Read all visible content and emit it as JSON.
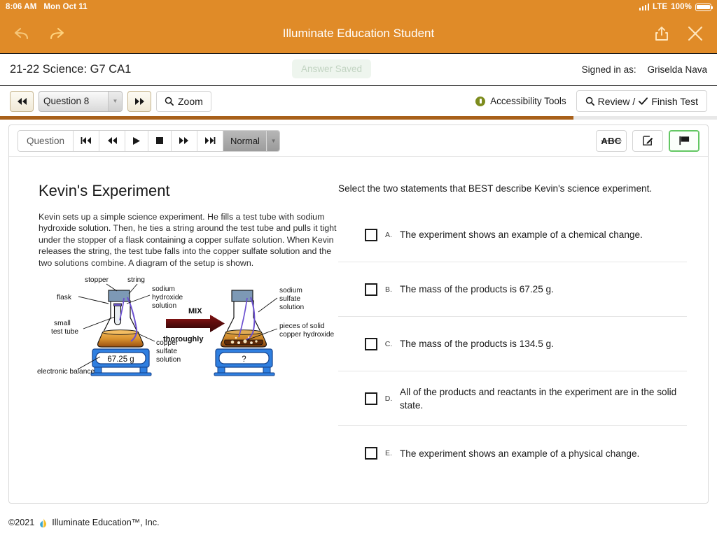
{
  "status_bar": {
    "time": "8:06 AM",
    "date": "Mon Oct 11",
    "network": "LTE",
    "battery": "100%"
  },
  "app_bar": {
    "title": "Illuminate Education Student",
    "back_icon": "back-arrow-icon",
    "forward_icon": "forward-arrow-icon",
    "share_icon": "share-icon",
    "close_icon": "close-icon"
  },
  "test_header": {
    "title": "21-22 Science: G7 CA1",
    "answer_saved": "Answer Saved",
    "signed_in_label": "Signed in as:",
    "user_name": "Griselda Nava"
  },
  "toolbar": {
    "prev_label": "◀◀",
    "next_label": "▶▶",
    "question_select": "Question 8",
    "zoom_label": "Zoom",
    "accessibility_label": "Accessibility Tools",
    "review_label": "Review /",
    "finish_label": "Finish Test",
    "progress_percent": 80
  },
  "media_bar": {
    "question_label": "Question",
    "skip_back_label": "⏮",
    "rewind_label": "⏪",
    "play_label": "▶",
    "stop_label": "■",
    "fast_forward_label": "⏩",
    "skip_forward_label": "⏭",
    "speed_label": "Normal",
    "strikethrough_label": "ABC",
    "notes_icon": "pencil-square-icon",
    "flag_icon": "flag-icon"
  },
  "question": {
    "title": "Kevin's Experiment",
    "passage": "Kevin sets up a simple science experiment. He fills a test tube with sodium hydroxide solution. Then, he ties a string around the test tube and pulls it tight under the stopper of a flask containing a copper sulfate solution. When Kevin releases the string, the test tube falls into the copper sulfate solution and the two solutions combine. A diagram of the setup is shown.",
    "prompt": "Select the two statements that BEST describe Kevin's science experiment.",
    "choices": [
      {
        "letter": "A.",
        "text": "The experiment shows an example of a chemical change."
      },
      {
        "letter": "B.",
        "text": "The mass of the products is 67.25 g."
      },
      {
        "letter": "C.",
        "text": "The mass of the products is 134.5 g."
      },
      {
        "letter": "D.",
        "text": "All of the products and reactants in the experiment are in the solid state."
      },
      {
        "letter": "E.",
        "text": "The experiment shows an example of a physical change."
      }
    ]
  },
  "diagram": {
    "labels": {
      "stopper": "stopper",
      "string": "string",
      "flask": "flask",
      "small_test_tube_line1": "small",
      "small_test_tube_line2": "test tube",
      "sodium_hydroxide_line1": "sodium",
      "sodium_hydroxide_line2": "hydroxide",
      "sodium_hydroxide_line3": "solution",
      "copper_sulfate_line1": "copper",
      "copper_sulfate_line2": "sulfate",
      "copper_sulfate_line3": "solution",
      "electronic_balance": "electronic balance",
      "mix": "MIX",
      "thoroughly": "thoroughly",
      "sodium_sulfate_line1": "sodium",
      "sodium_sulfate_line2": "sulfate",
      "sodium_sulfate_line3": "solution",
      "copper_hydroxide_line1": "pieces of solid",
      "copper_hydroxide_line2": "copper hydroxide"
    },
    "balance_reading_before": "67.25 g",
    "balance_reading_after": "?"
  },
  "footer": {
    "copyright": "©2021",
    "company": "Illuminate Education™, Inc."
  },
  "colors": {
    "app_bar": "#e08b28",
    "progress_fill": "#a8601a",
    "flag_accent": "#63c763",
    "accessibility_icon": "#7d8c1e"
  }
}
